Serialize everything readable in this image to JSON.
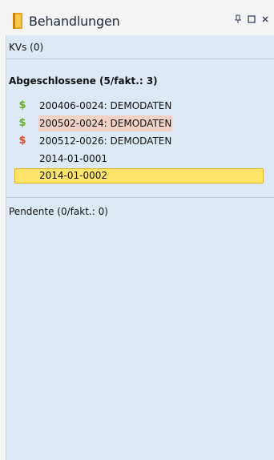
{
  "panel": {
    "title": "Behandlungen",
    "buttons": {
      "pin": "⭛",
      "maximize": "□",
      "close": "×"
    }
  },
  "kvs": {
    "label": "KVs (0)"
  },
  "completed_group": {
    "header": "Abgeschlossene (5/fakt.: 3)",
    "items": [
      {
        "label": "200406-0024: DEMODATEN",
        "billing_icon": "dollar-icon",
        "billing_color": "#6aae2c",
        "highlighted": false,
        "selected": false
      },
      {
        "label": "200502-0024: DEMODATEN",
        "billing_icon": "dollar-icon",
        "billing_color": "#6aae2c",
        "highlighted": true,
        "selected": false
      },
      {
        "label": "200512-0026: DEMODATEN",
        "billing_icon": "dollar-icon",
        "billing_color": "#d84a2e",
        "highlighted": false,
        "selected": false
      },
      {
        "label": "2014-01-0001",
        "billing_icon": "",
        "highlighted": false,
        "selected": false
      },
      {
        "label": "2014-01-0002",
        "billing_icon": "",
        "highlighted": false,
        "selected": true
      }
    ]
  },
  "pending": {
    "label": "Pendente (0/fakt.: 0)"
  },
  "colors": {
    "panel_background": "#dde9f5",
    "selection_fill": "#ffe46a",
    "selection_border": "#e0b126",
    "highlight_fill": "#f2d2c6",
    "billed_green": "#6aae2c",
    "billed_red": "#d84a2e"
  }
}
